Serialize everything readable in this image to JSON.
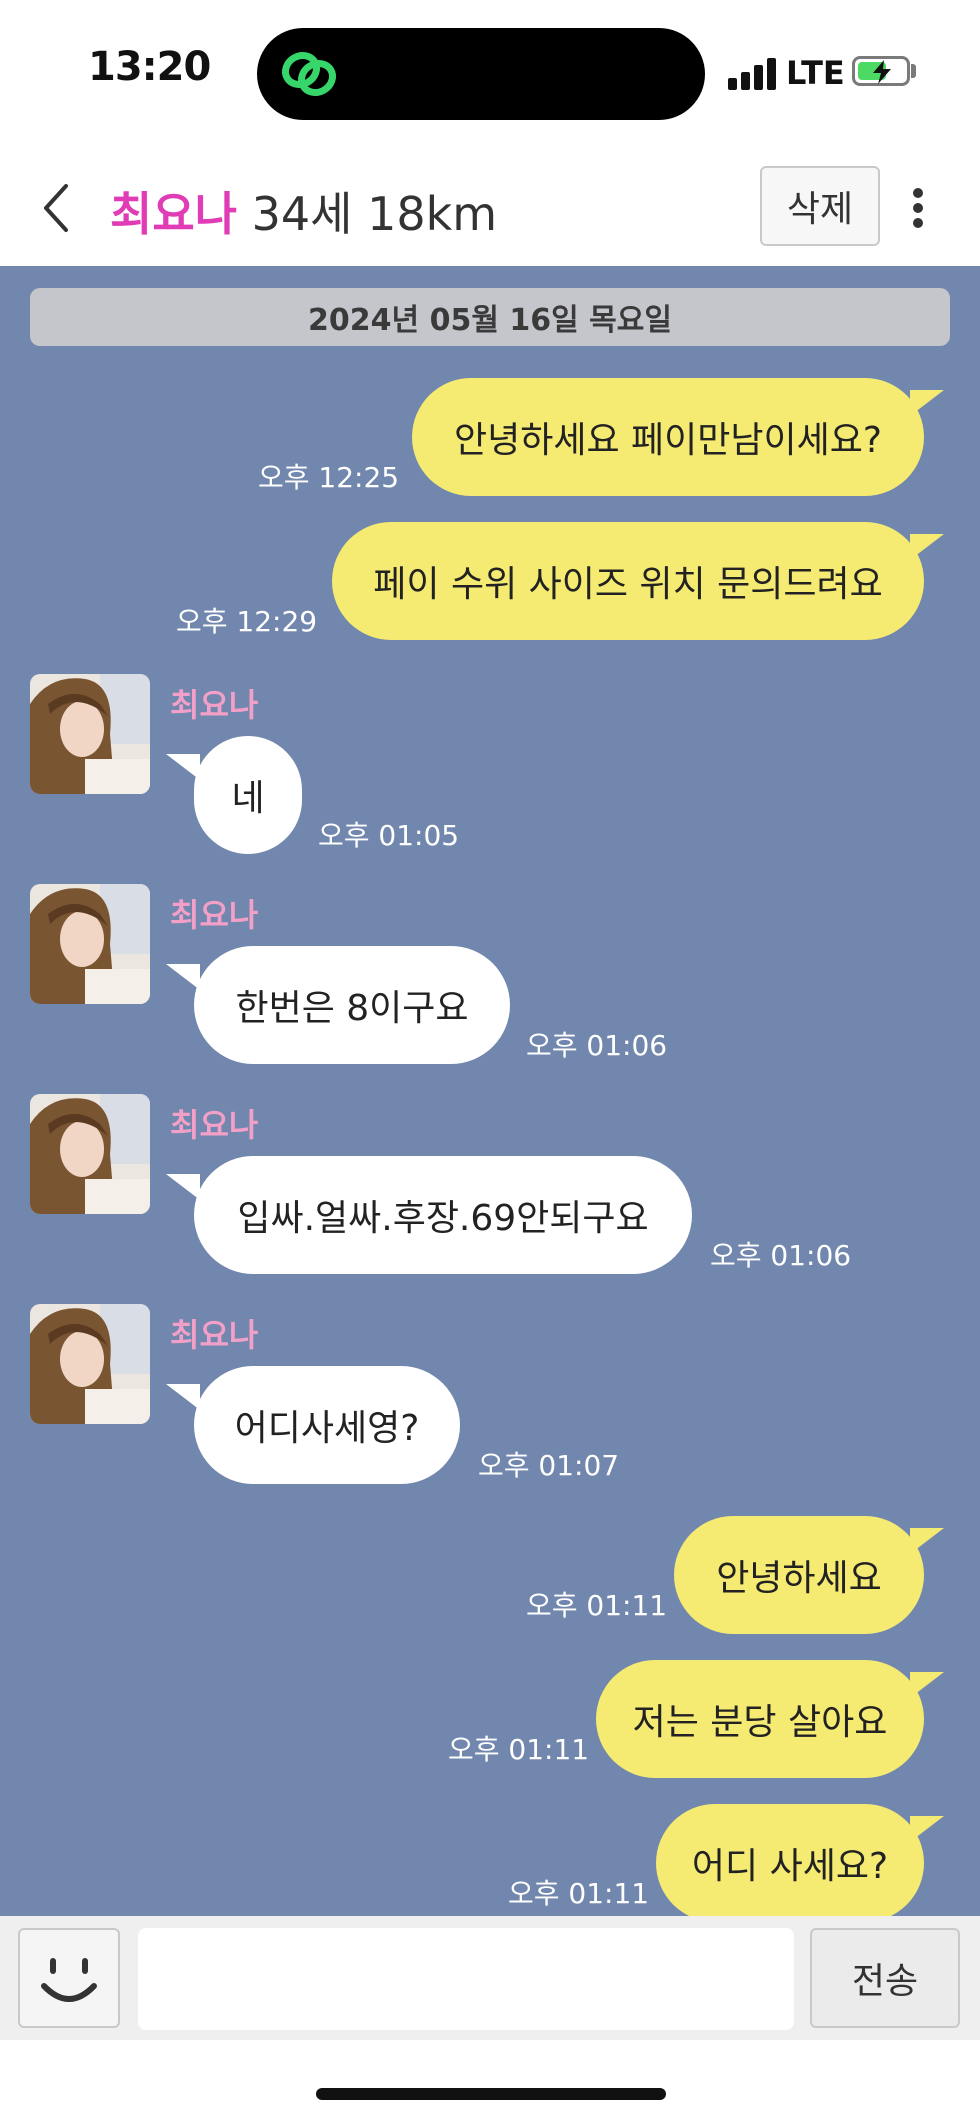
{
  "status_bar": {
    "time": "13:20",
    "network": "LTE",
    "battery_level": 0.6
  },
  "header": {
    "contact_name": "최요나",
    "contact_info": "34세 18km",
    "delete_label": "삭제",
    "back_icon": "chevron-left-icon",
    "more_icon": "more-vertical-icon"
  },
  "chat": {
    "date": "2024년 05월 16일 목요일",
    "messages": [
      {
        "from": "me",
        "text": "안녕하세요 페이만남이세요?",
        "time": "오후 12:25"
      },
      {
        "from": "me",
        "text": "페이 수위 사이즈 위치 문의드려요",
        "time": "오후 12:29"
      },
      {
        "from": "them",
        "sender": "최요나",
        "text": "네",
        "time": "오후 01:05"
      },
      {
        "from": "them",
        "sender": "최요나",
        "text": "한번은 8이구요",
        "time": "오후 01:06"
      },
      {
        "from": "them",
        "sender": "최요나",
        "text": "입싸.얼싸.후장.69안되구요",
        "time": "오후 01:06"
      },
      {
        "from": "them",
        "sender": "최요나",
        "text": "어디사세영?",
        "time": "오후 01:07"
      },
      {
        "from": "me",
        "text": "안녕하세요",
        "time": "오후 01:11"
      },
      {
        "from": "me",
        "text": "저는 분당 살아요",
        "time": "오후 01:11"
      },
      {
        "from": "me",
        "text": "어디 사세요?",
        "time": "오후 01:11"
      }
    ]
  },
  "input_bar": {
    "placeholder": "",
    "send_label": "전송",
    "emoji_icon": "smiley-icon"
  },
  "colors": {
    "chat_bg": "#7287ad",
    "my_bubble": "#f5ea72",
    "their_bubble": "#ffffff",
    "name_accent": "#e03cb6",
    "sender_name": "#f2a0c8"
  }
}
